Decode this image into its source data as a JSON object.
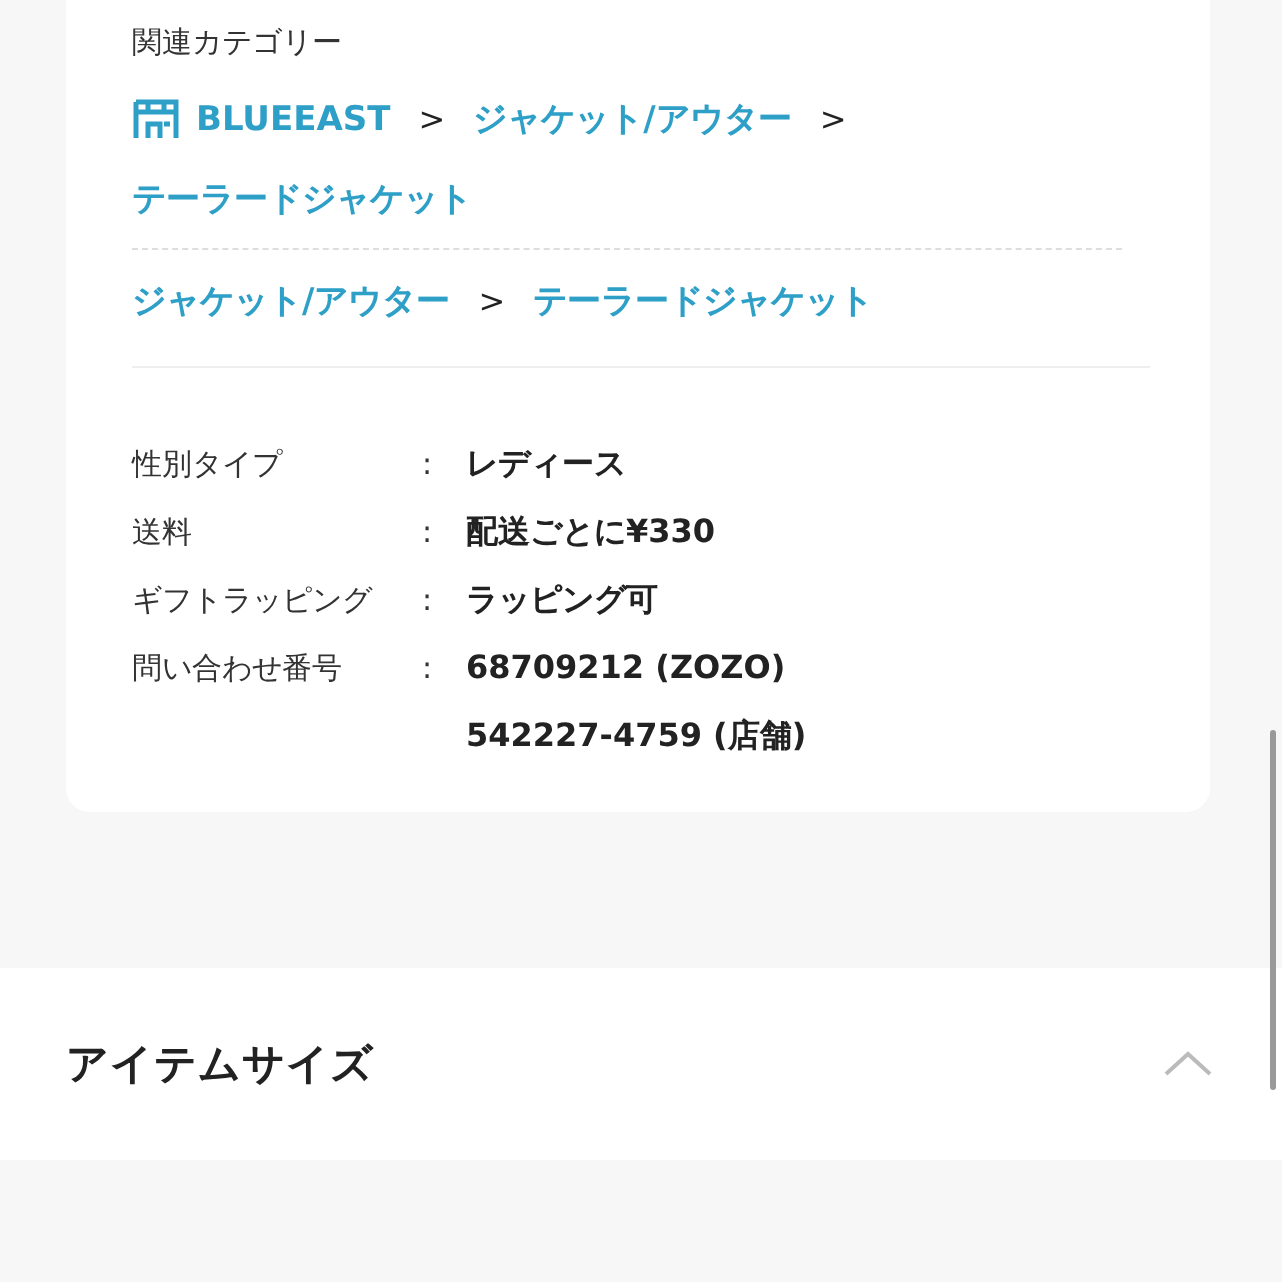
{
  "related_categories": {
    "title": "関連カテゴリー",
    "paths": [
      {
        "kind": "shop",
        "items": [
          "BLUEEAST",
          "ジャケット/アウター",
          "テーラードジャケット"
        ]
      },
      {
        "kind": "plain",
        "items": [
          "ジャケット/アウター",
          "テーラードジャケット"
        ]
      }
    ]
  },
  "details": [
    {
      "label": "性別タイプ",
      "values": [
        "レディース"
      ]
    },
    {
      "label": "送料",
      "values": [
        "配送ごとに¥330"
      ]
    },
    {
      "label": "ギフトラッピング",
      "values": [
        "ラッピング可"
      ]
    },
    {
      "label": "問い合わせ番号",
      "values": [
        "68709212 (ZOZO)",
        "542227-4759 (店舗)"
      ]
    }
  ],
  "separator": ">",
  "colon": ":",
  "section": {
    "title": "アイテムサイズ",
    "expanded": true
  }
}
